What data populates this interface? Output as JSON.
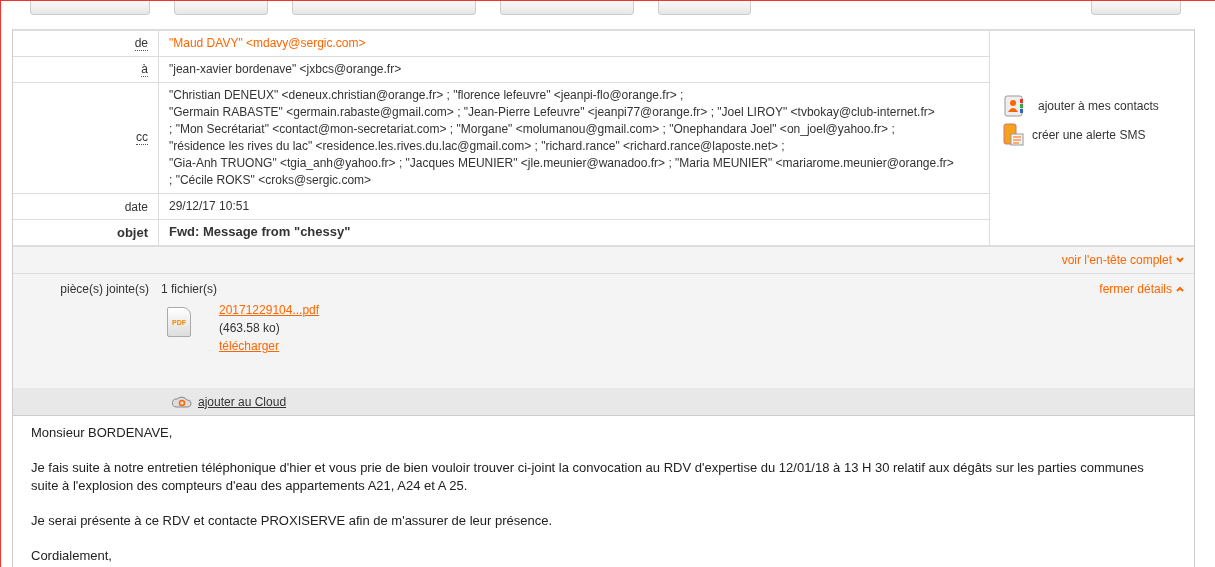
{
  "header": {
    "rows": [
      {
        "label": "de",
        "kind": "link",
        "lines": [
          "\"Maud DAVY\" <mdavy@sergic.com>"
        ]
      },
      {
        "label": "à",
        "kind": "plain",
        "lines": [
          "\"jean-xavier bordenave\" <jxbcs@orange.fr>"
        ]
      },
      {
        "label": "cc",
        "kind": "plain",
        "lines": [
          "\"Christian DENEUX\" <deneux.christian@orange.fr> ;  \"florence lefeuvre\" <jeanpi-flo@orange.fr> ;",
          "\"Germain RABASTE\" <germain.rabaste@gmail.com> ;  \"Jean-Pierre Lefeuvre\" <jeanpi77@orange.fr> ;  \"Joel LIROY\" <tvbokay@club-internet.fr>",
          ";  \"Mon Secrétariat\" <contact@mon-secretariat.com> ;  \"Morgane\" <molumanou@gmail.com> ;  \"Onephandara Joel\" <on_joel@yahoo.fr> ;",
          "\"résidence les rives du lac\" <residence.les.rives.du.lac@gmail.com> ;  \"richard.rance\" <richard.rance@laposte.net> ;",
          "\"Gia-Anh TRUONG\" <tgia_anh@yahoo.fr> ;  \"Jacques MEUNIER\" <jle.meunier@wanadoo.fr> ;  \"Maria MEUNIER\" <mariarome.meunier@orange.fr>",
          ";  \"Cécile ROKS\" <croks@sergic.com>"
        ]
      },
      {
        "label": "date",
        "kind": "plain",
        "lines": [
          "29/12/17 10:51"
        ]
      },
      {
        "label": "objet",
        "kind": "bold",
        "lines": [
          "Fwd: Message from \"chessy\""
        ]
      }
    ],
    "actions": [
      "ajouter à mes contacts",
      "créer une alerte SMS"
    ],
    "full_header_link": "voir l'en-tête complet"
  },
  "attachments": {
    "label": "pièce(s) jointe(s)",
    "count": "1 fichier(s)",
    "close_link": "fermer détails",
    "file": {
      "name": "20171229104...pdf",
      "size": "(463.58 ko)",
      "download": "télécharger",
      "icon_text": "PDF"
    },
    "cloud_link": "ajouter au Cloud"
  },
  "body": [
    "Monsieur BORDENAVE,",
    "Je fais suite à notre entretien téléphonique d'hier et vous prie de bien vouloir trouver ci-joint la convocation au RDV d'expertise du 12/01/18 à 13 H 30 relatif aux dégâts sur les parties communes suite à l'explosion des compteurs d'eau des appartements A21, A24 et A 25.",
    "Je serai présente à ce RDV et contacte PROXISERVE afin de m'assurer de leur présence.",
    "Cordialement,"
  ]
}
